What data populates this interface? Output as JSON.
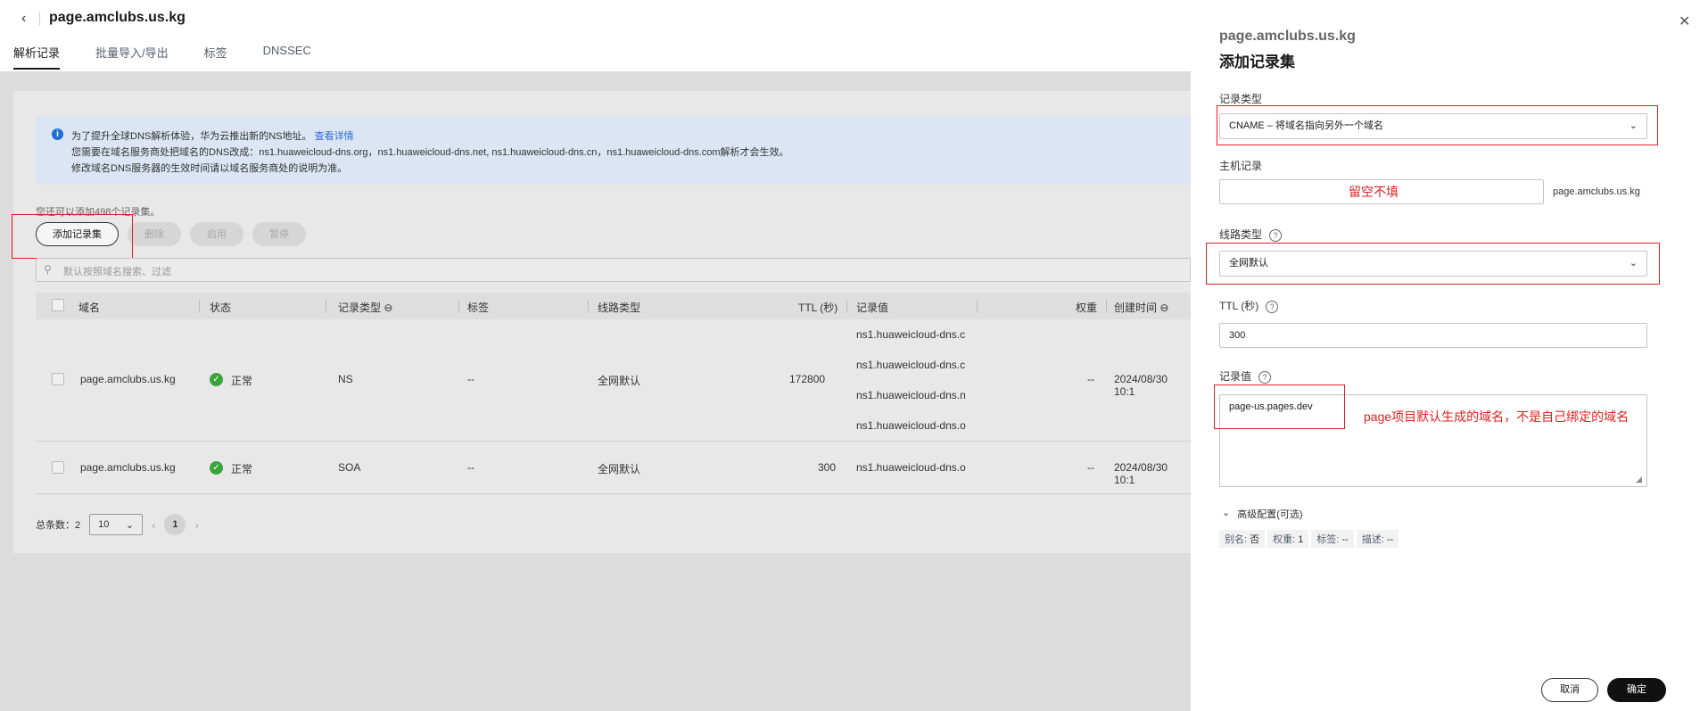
{
  "header": {
    "title": "page.amclubs.us.kg"
  },
  "tabs": [
    "解析记录",
    "批量导入/导出",
    "标签",
    "DNSSEC"
  ],
  "notice": {
    "line1": "为了提升全球DNS解析体验，华为云推出新的NS地址。",
    "link": "查看详情",
    "line2": "您需要在域名服务商处把域名的DNS改成：ns1.huaweicloud-dns.org，ns1.huaweicloud-dns.net, ns1.huaweicloud-dns.cn，ns1.huaweicloud-dns.com解析才会生效。",
    "line3": "修改域名DNS服务器的生效时间请以域名服务商处的说明为准。"
  },
  "quota_text": "您还可以添加498个记录集。",
  "toolbar": {
    "add": "添加记录集",
    "delete": "删除",
    "enable": "启用",
    "pause": "暂停"
  },
  "search": {
    "placeholder": "默认按照域名搜索、过滤"
  },
  "table": {
    "headers": {
      "domain": "域名",
      "status": "状态",
      "type": "记录类型",
      "tag": "标签",
      "line": "线路类型",
      "ttl": "TTL (秒)",
      "value": "记录值",
      "weight": "权重",
      "created": "创建时间"
    },
    "rows": [
      {
        "domain": "page.amclubs.us.kg",
        "status": "正常",
        "type": "NS",
        "tag": "--",
        "line": "全网默认",
        "ttl": "172800",
        "values": [
          "ns1.huaweicloud-dns.c",
          "ns1.huaweicloud-dns.c",
          "ns1.huaweicloud-dns.n",
          "ns1.huaweicloud-dns.o"
        ],
        "weight": "--",
        "created": "2024/08/30 10:1"
      },
      {
        "domain": "page.amclubs.us.kg",
        "status": "正常",
        "type": "SOA",
        "tag": "--",
        "line": "全网默认",
        "ttl": "300",
        "values": [
          "ns1.huaweicloud-dns.o"
        ],
        "weight": "--",
        "created": "2024/08/30 10:1"
      }
    ]
  },
  "pager": {
    "total_label": "总条数：2",
    "page_size": "10",
    "current": "1"
  },
  "drawer": {
    "subtitle": "page.amclubs.us.kg",
    "title": "添加记录集",
    "record_type_label": "记录类型",
    "record_type_value": "CNAME – 将域名指向另外一个域名",
    "host_label": "主机记录",
    "host_note": "留空不填",
    "host_suffix": "page.amclubs.us.kg",
    "line_label": "线路类型",
    "line_value": "全网默认",
    "ttl_label": "TTL (秒)",
    "ttl_value": "300",
    "value_label": "记录值",
    "value_text": "page-us.pages.dev",
    "value_note": "page项目默认生成的域名，不是自己绑定的域名",
    "advanced": "高级配置(可选)",
    "chips": [
      {
        "k": "别名:",
        "v": "否"
      },
      {
        "k": "权重:",
        "v": "1"
      },
      {
        "k": "标签:",
        "v": "--"
      },
      {
        "k": "描述:",
        "v": "--"
      }
    ],
    "cancel": "取消",
    "ok": "确定"
  },
  "colors": {
    "accent": "#1d6fd6",
    "annotation": "#e02020",
    "success": "#3ba33b",
    "primary_btn": "#111111"
  }
}
